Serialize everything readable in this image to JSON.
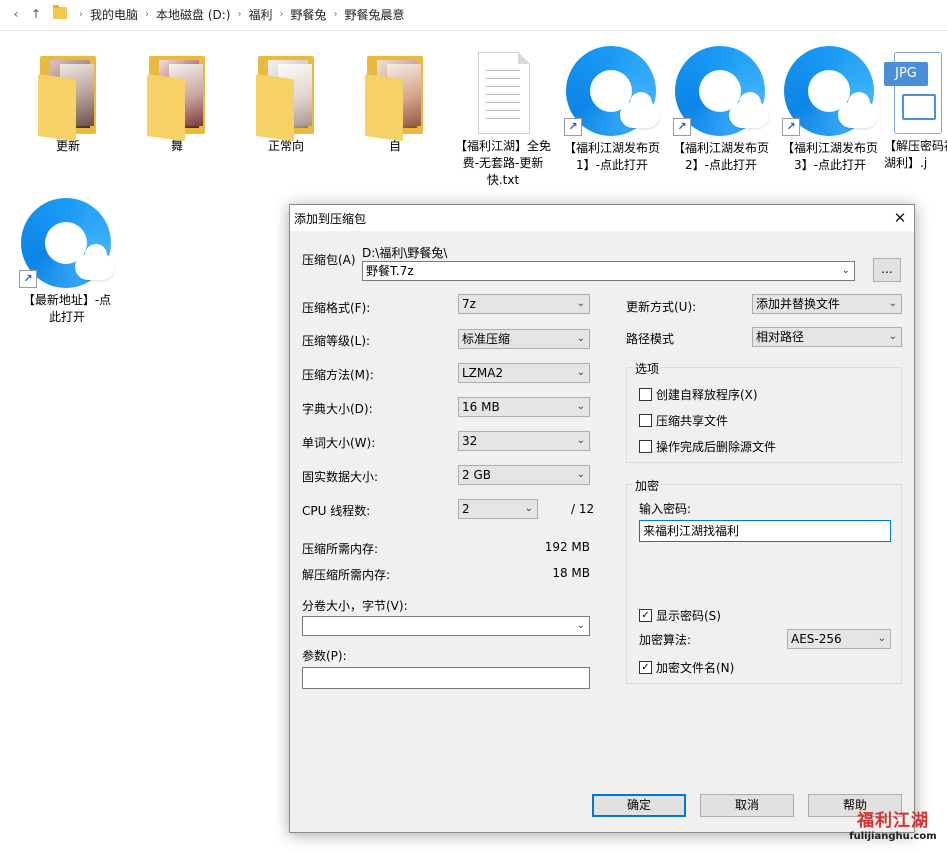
{
  "address_bar": {
    "back_glyph": "‹",
    "up_glyph": "↑",
    "separator": "›",
    "crumbs": [
      "我的电脑",
      "本地磁盘 (D:)",
      "福利",
      "野餐兔",
      "野餐兔晨意"
    ]
  },
  "files": {
    "folders": [
      {
        "label": "更新"
      },
      {
        "label": "舞"
      },
      {
        "label": "正常向"
      },
      {
        "label": "自"
      }
    ],
    "txt_file": {
      "label": "【福利江湖】全免费-无套路-更新快.txt"
    },
    "shortcuts": [
      {
        "label": "【福利江湖发布页1】-点此打开"
      },
      {
        "label": "【福利江湖发布页2】-点此打开"
      },
      {
        "label": "【福利江湖发布页3】-点此打开"
      },
      {
        "label": "【最新地址】-点此打开"
      }
    ],
    "jpg_file": {
      "tag": "JPG",
      "label": "【解压密码福利江湖利】.j"
    }
  },
  "dialog": {
    "title": "添加到压缩包",
    "close_glyph": "✕",
    "archive_label": "压缩包(A)",
    "archive_path": "D:\\福利\\野餐兔\\",
    "archive_name": "野餐T.7z",
    "browse_label": "...",
    "format_label": "压缩格式(F):",
    "format_value": "7z",
    "level_label": "压缩等级(L):",
    "level_value": "标准压缩",
    "method_label": "压缩方法(M):",
    "method_value": "LZMA2",
    "dict_label": "字典大小(D):",
    "dict_value": "16 MB",
    "word_label": "单词大小(W):",
    "word_value": "32",
    "solid_label": "固实数据大小:",
    "solid_value": "2 GB",
    "cpu_label": "CPU 线程数:",
    "cpu_value": "2",
    "cpu_max": "/ 12",
    "mem_comp_label": "压缩所需内存:",
    "mem_comp_value": "192 MB",
    "mem_decomp_label": "解压缩所需内存:",
    "mem_decomp_value": "18 MB",
    "volume_label": "分卷大小，字节(V):",
    "volume_value": "",
    "params_label": "参数(P):",
    "params_value": "",
    "update_label": "更新方式(U):",
    "update_value": "添加并替换文件",
    "path_label": "路径模式",
    "path_value": "相对路径",
    "options_title": "选项",
    "options": [
      {
        "label": "创建自释放程序(X)",
        "checked": false
      },
      {
        "label": "压缩共享文件",
        "checked": false
      },
      {
        "label": "操作完成后删除源文件",
        "checked": false
      }
    ],
    "encrypt_title": "加密",
    "password_label": "输入密码:",
    "password_value": "来福利江湖找福利",
    "show_password": {
      "label": "显示密码(S)",
      "checked": true
    },
    "enc_method_label": "加密算法:",
    "enc_method_value": "AES-256",
    "encrypt_names": {
      "label": "加密文件名(N)",
      "checked": true
    },
    "ok_label": "确定",
    "cancel_label": "取消",
    "help_label": "帮助",
    "check_glyph": "✓",
    "dropdown_glyph": "⌄"
  },
  "watermark": {
    "logo_text": "福利江湖",
    "site": "fulijianghu.com"
  }
}
